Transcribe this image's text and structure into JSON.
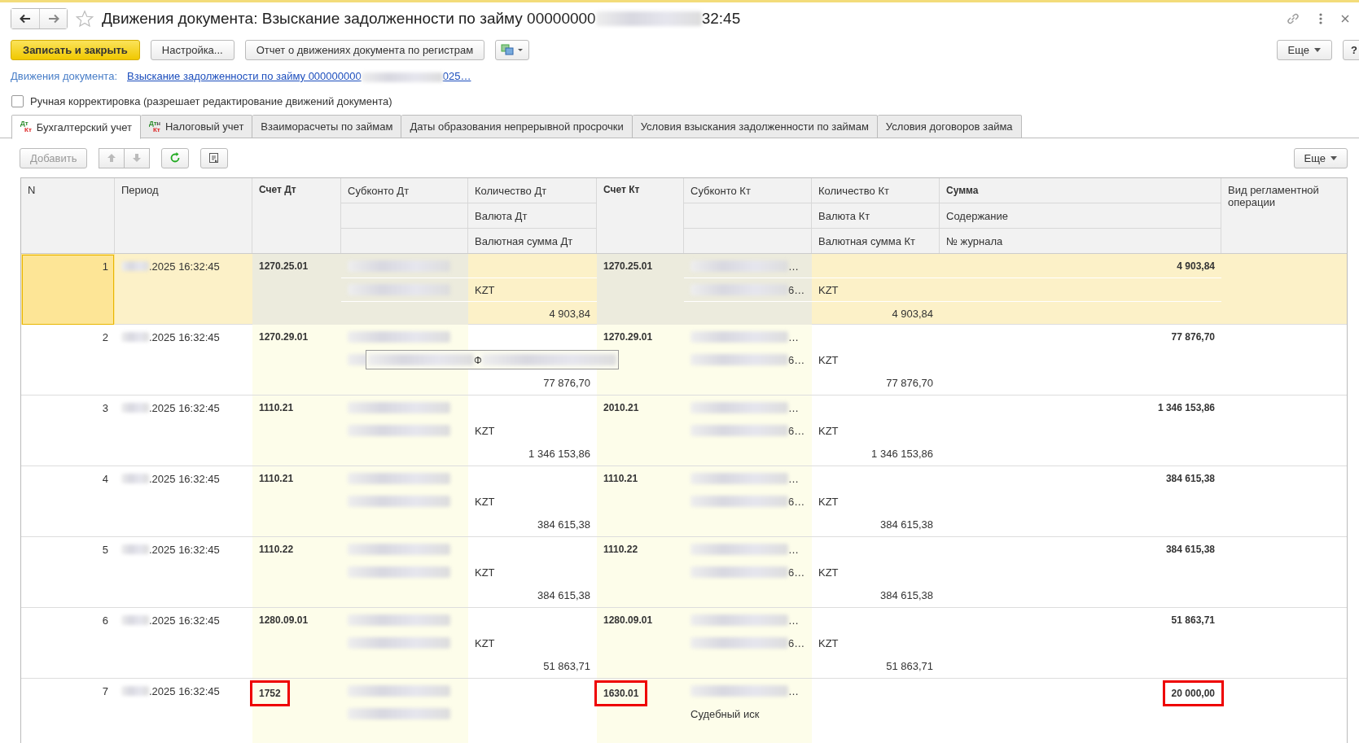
{
  "window": {
    "title_start": "Движения документа: Взыскание задолженности по займу 00000000",
    "title_end": "32:45"
  },
  "command_bar": {
    "buttons": [
      {
        "label": "Записать и закрыть",
        "kind": "primary"
      },
      {
        "label": "Настройка...",
        "kind": "plain"
      },
      {
        "label": "Отчет о движениях документа по регистрам",
        "kind": "plain"
      }
    ],
    "more": "Еще",
    "help": "?"
  },
  "document_link": {
    "label": "Движения документа:",
    "link_start": "Взыскание задолженности по займу 000000000",
    "link_end": "025…"
  },
  "manual_edit": {
    "label": "Ручная корректировка (разрешает редактирование движений документа)",
    "checked": false
  },
  "tabs": [
    {
      "label": "Бухгалтерский учет",
      "selected": true,
      "icon": {
        "top": "Дт",
        "bottom": "Кт"
      }
    },
    {
      "label": "Налоговый учет",
      "selected": false,
      "icon": {
        "top": "Дт",
        "sup": "Н",
        "bottom": "Кт"
      }
    },
    {
      "label": "Взаиморасчеты по займам",
      "selected": false
    },
    {
      "label": "Даты образования непрерывной просрочки",
      "selected": false
    },
    {
      "label": "Условия взыскания задолженности по займам",
      "selected": false
    },
    {
      "label": "Условия договоров займа",
      "selected": false
    }
  ],
  "table_toolbar": {
    "add": {
      "label": "Добавить",
      "disabled": true
    },
    "more": "Еще"
  },
  "table": {
    "columns": [
      {
        "kind": "single",
        "lines": [
          "N"
        ]
      },
      {
        "kind": "single",
        "lines": [
          "Период"
        ]
      },
      {
        "kind": "single",
        "lines": [
          "Счет Дт"
        ],
        "bold": true
      },
      {
        "kind": "stacked",
        "lines": [
          "Субконто Дт"
        ]
      },
      {
        "kind": "stacked",
        "lines": [
          "Количество Дт",
          "Валюта Дт",
          "Валютная сумма Дт"
        ]
      },
      {
        "kind": "single",
        "lines": [
          "Счет Кт"
        ],
        "bold": true
      },
      {
        "kind": "stacked",
        "lines": [
          "Субконто Кт"
        ]
      },
      {
        "kind": "stacked",
        "lines": [
          "Количество Кт",
          "Валюта Кт",
          "Валютная сумма Кт"
        ]
      },
      {
        "kind": "stacked",
        "lines": [
          "Сумма",
          "Содержание",
          "№ журнала"
        ],
        "bold": true
      },
      {
        "kind": "single",
        "lines": [
          "Вид регламентной операции"
        ]
      }
    ],
    "rows": [
      {
        "n": "1",
        "period": ".2025 16:32:45",
        "selected": true,
        "dt": {
          "account": "1270.25.01",
          "highlighted": false
        },
        "qty_dt": {
          "currency": "KZT",
          "amount": "4 903,84"
        },
        "kt": {
          "account": "1270.25.01",
          "highlighted": false
        },
        "sub_kt": [
          {
            "blur": true,
            "text": "…"
          },
          {
            "blur": true,
            "text": "6…"
          }
        ],
        "qty_kt": {
          "currency": "KZT",
          "amount": "4 903,84"
        },
        "sum": {
          "amount": "4 903,84",
          "highlighted": false
        }
      },
      {
        "n": "2",
        "period": ".2025 16:32:45",
        "selected": false,
        "tooltip": "Ф",
        "dt": {
          "account": "1270.29.01",
          "highlighted": false
        },
        "qty_dt": {
          "amount": "77 876,70"
        },
        "kt": {
          "account": "1270.29.01",
          "highlighted": false
        },
        "sub_kt": [
          {
            "blur": true,
            "text": "…"
          },
          {
            "blur": true,
            "text": "6…"
          }
        ],
        "qty_kt": {
          "currency": "KZT",
          "amount": "77 876,70"
        },
        "sum": {
          "amount": "77 876,70",
          "highlighted": false
        }
      },
      {
        "n": "3",
        "period": ".2025 16:32:45",
        "selected": false,
        "dt": {
          "account": "1110.21",
          "highlighted": false
        },
        "qty_dt": {
          "currency": "KZT",
          "amount": "1 346 153,86"
        },
        "kt": {
          "account": "2010.21",
          "highlighted": false
        },
        "sub_kt": [
          {
            "blur": true,
            "text": "…"
          },
          {
            "blur": true,
            "text": "6…"
          }
        ],
        "qty_kt": {
          "currency": "KZT",
          "amount": "1 346 153,86"
        },
        "sum": {
          "amount": "1 346 153,86",
          "highlighted": false
        }
      },
      {
        "n": "4",
        "period": ".2025 16:32:45",
        "selected": false,
        "dt": {
          "account": "1110.21",
          "highlighted": false
        },
        "qty_dt": {
          "currency": "KZT",
          "amount": "384 615,38"
        },
        "kt": {
          "account": "1110.21",
          "highlighted": false
        },
        "sub_kt": [
          {
            "blur": true,
            "text": "…"
          },
          {
            "blur": true,
            "text": "6…"
          }
        ],
        "qty_kt": {
          "currency": "KZT",
          "amount": "384 615,38"
        },
        "sum": {
          "amount": "384 615,38",
          "highlighted": false
        }
      },
      {
        "n": "5",
        "period": ".2025 16:32:45",
        "selected": false,
        "dt": {
          "account": "1110.22",
          "highlighted": false
        },
        "qty_dt": {
          "currency": "KZT",
          "amount": "384 615,38"
        },
        "kt": {
          "account": "1110.22",
          "highlighted": false
        },
        "sub_kt": [
          {
            "blur": true,
            "text": "…"
          },
          {
            "blur": true,
            "text": "6…"
          }
        ],
        "qty_kt": {
          "currency": "KZT",
          "amount": "384 615,38"
        },
        "sum": {
          "amount": "384 615,38",
          "highlighted": false
        }
      },
      {
        "n": "6",
        "period": ".2025 16:32:45",
        "selected": false,
        "dt": {
          "account": "1280.09.01",
          "highlighted": false
        },
        "qty_dt": {
          "currency": "KZT",
          "amount": "51 863,71"
        },
        "kt": {
          "account": "1280.09.01",
          "highlighted": false
        },
        "sub_kt": [
          {
            "blur": true,
            "text": "…"
          },
          {
            "blur": true,
            "text": "6…"
          }
        ],
        "qty_kt": {
          "currency": "KZT",
          "amount": "51 863,71"
        },
        "sum": {
          "amount": "51 863,71",
          "highlighted": false
        }
      },
      {
        "n": "7",
        "period": ".2025 16:32:45",
        "selected": false,
        "dt": {
          "account": "1752",
          "highlighted": true
        },
        "qty_dt": {},
        "kt": {
          "account": "1630.01",
          "highlighted": true
        },
        "sub_kt": [
          {
            "blur": true,
            "text": "…"
          },
          {
            "blur": false,
            "text": "Судебный иск"
          }
        ],
        "qty_kt": {},
        "sum": {
          "amount": "20 000,00",
          "highlighted": true
        }
      }
    ]
  }
}
